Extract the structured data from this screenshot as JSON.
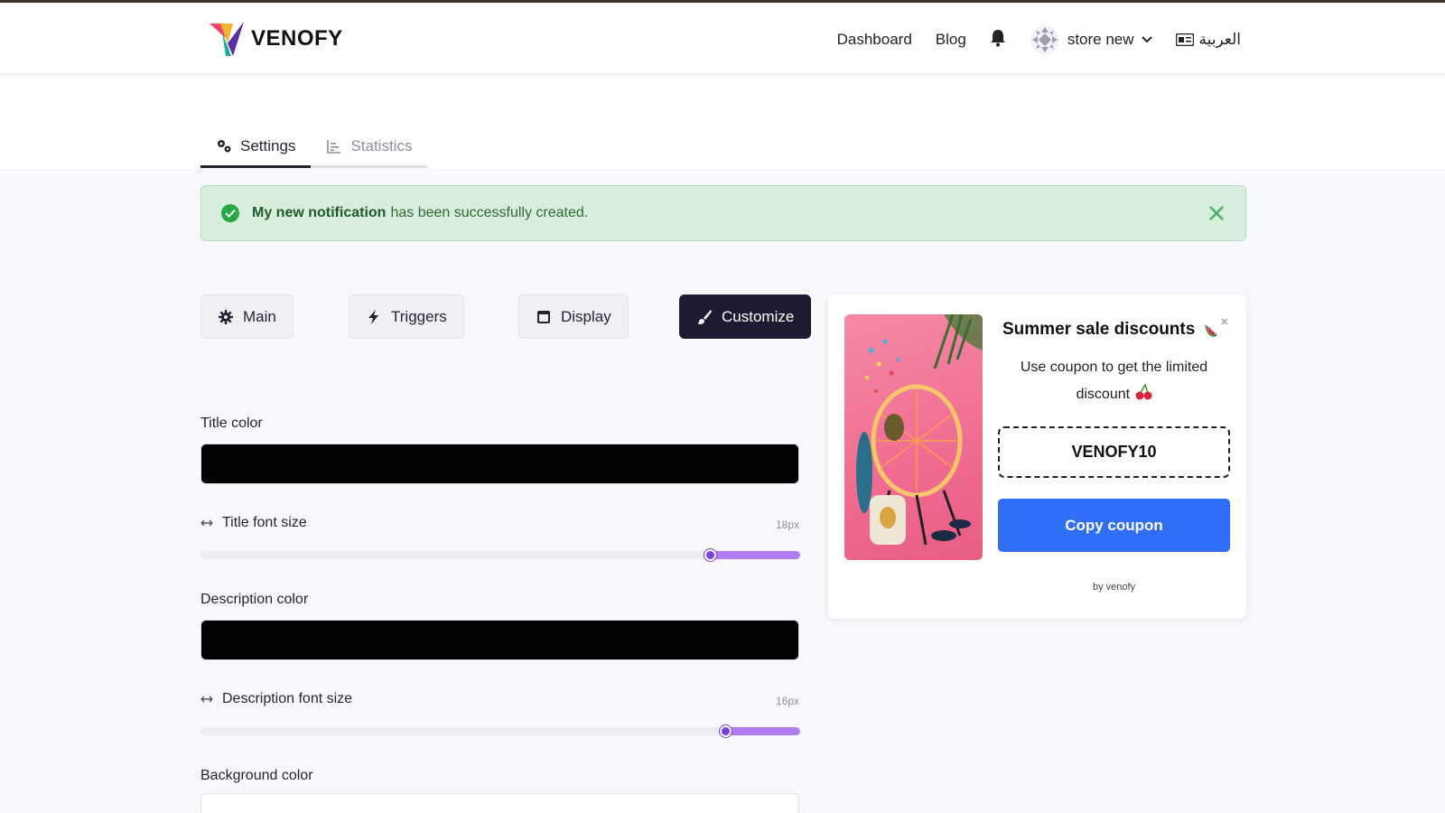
{
  "brand": {
    "name": "VENOFY",
    "colors": {
      "accent": "#1d1a33",
      "success": "#28a745",
      "slider": "#b07cf0",
      "primary_button": "#2f6ef5"
    }
  },
  "nav": {
    "dashboard": "Dashboard",
    "blog": "Blog",
    "bell_icon": "bell-icon",
    "store": "store new",
    "language": "العربية"
  },
  "tabs": [
    {
      "label": "Settings",
      "icon": "gears-icon",
      "active": true
    },
    {
      "label": "Statistics",
      "icon": "bar-chart-icon",
      "active": false
    }
  ],
  "alert": {
    "bold": "My new notification",
    "text": "has been successfully created."
  },
  "sections": [
    {
      "label": "Main",
      "icon": "gear-icon",
      "active": false
    },
    {
      "label": "Triggers",
      "icon": "bolt-icon",
      "active": false
    },
    {
      "label": "Display",
      "icon": "window-icon",
      "active": false
    },
    {
      "label": "Customize",
      "icon": "brush-icon",
      "active": true
    }
  ],
  "form": {
    "title_color": {
      "label": "Title color",
      "value": "#000000"
    },
    "title_font_size": {
      "label": "Title font size",
      "value": "18px",
      "fraction": 0.85
    },
    "description_color": {
      "label": "Description color",
      "value": "#000000"
    },
    "description_font_size": {
      "label": "Description font size",
      "value": "16px",
      "fraction": 0.875
    },
    "background_color": {
      "label": "Background color",
      "value": "#ffffff"
    }
  },
  "preview": {
    "title": "Summer sale discounts",
    "title_emoji": "watermelon-icon",
    "description": "Use coupon to get the limited discount",
    "description_emoji": "cherries-icon",
    "coupon": "VENOFY10",
    "button": "Copy coupon",
    "footer": "by venofy",
    "close": "×"
  }
}
